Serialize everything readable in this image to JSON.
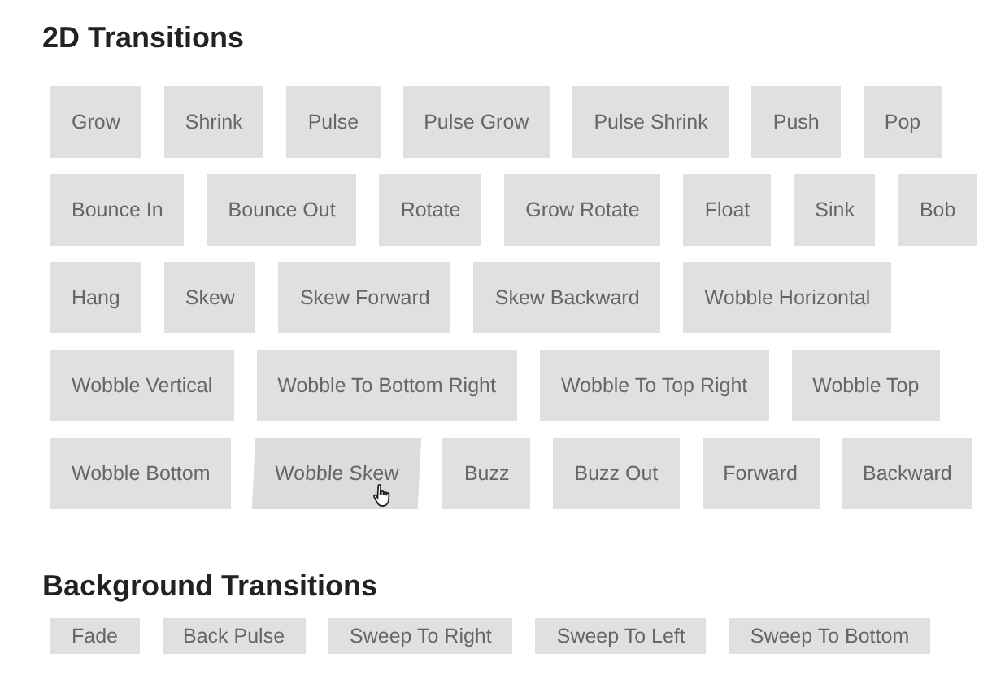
{
  "sections": [
    {
      "title": "2D Transitions",
      "buttons": [
        {
          "label": "Grow",
          "hovered": false
        },
        {
          "label": "Shrink",
          "hovered": false
        },
        {
          "label": "Pulse",
          "hovered": false
        },
        {
          "label": "Pulse Grow",
          "hovered": false
        },
        {
          "label": "Pulse Shrink",
          "hovered": false
        },
        {
          "label": "Push",
          "hovered": false
        },
        {
          "label": "Pop",
          "hovered": false
        },
        {
          "label": "Bounce In",
          "hovered": false
        },
        {
          "label": "Bounce Out",
          "hovered": false
        },
        {
          "label": "Rotate",
          "hovered": false
        },
        {
          "label": "Grow Rotate",
          "hovered": false
        },
        {
          "label": "Float",
          "hovered": false
        },
        {
          "label": "Sink",
          "hovered": false
        },
        {
          "label": "Bob",
          "hovered": false
        },
        {
          "label": "Hang",
          "hovered": false
        },
        {
          "label": "Skew",
          "hovered": false
        },
        {
          "label": "Skew Forward",
          "hovered": false
        },
        {
          "label": "Skew Backward",
          "hovered": false
        },
        {
          "label": "Wobble Horizontal",
          "hovered": false
        },
        {
          "label": "Wobble Vertical",
          "hovered": false
        },
        {
          "label": "Wobble To Bottom Right",
          "hovered": false
        },
        {
          "label": "Wobble To Top Right",
          "hovered": false
        },
        {
          "label": "Wobble Top",
          "hovered": false
        },
        {
          "label": "Wobble Bottom",
          "hovered": false
        },
        {
          "label": "Wobble Skew",
          "hovered": true
        },
        {
          "label": "Buzz",
          "hovered": false
        },
        {
          "label": "Buzz Out",
          "hovered": false
        },
        {
          "label": "Forward",
          "hovered": false
        },
        {
          "label": "Backward",
          "hovered": false
        }
      ]
    },
    {
      "title": "Background Transitions",
      "buttons": [
        {
          "label": "Fade",
          "hovered": false
        },
        {
          "label": "Back Pulse",
          "hovered": false
        },
        {
          "label": "Sweep To Right",
          "hovered": false
        },
        {
          "label": "Sweep To Left",
          "hovered": false
        },
        {
          "label": "Sweep To Bottom",
          "hovered": false
        }
      ]
    }
  ]
}
